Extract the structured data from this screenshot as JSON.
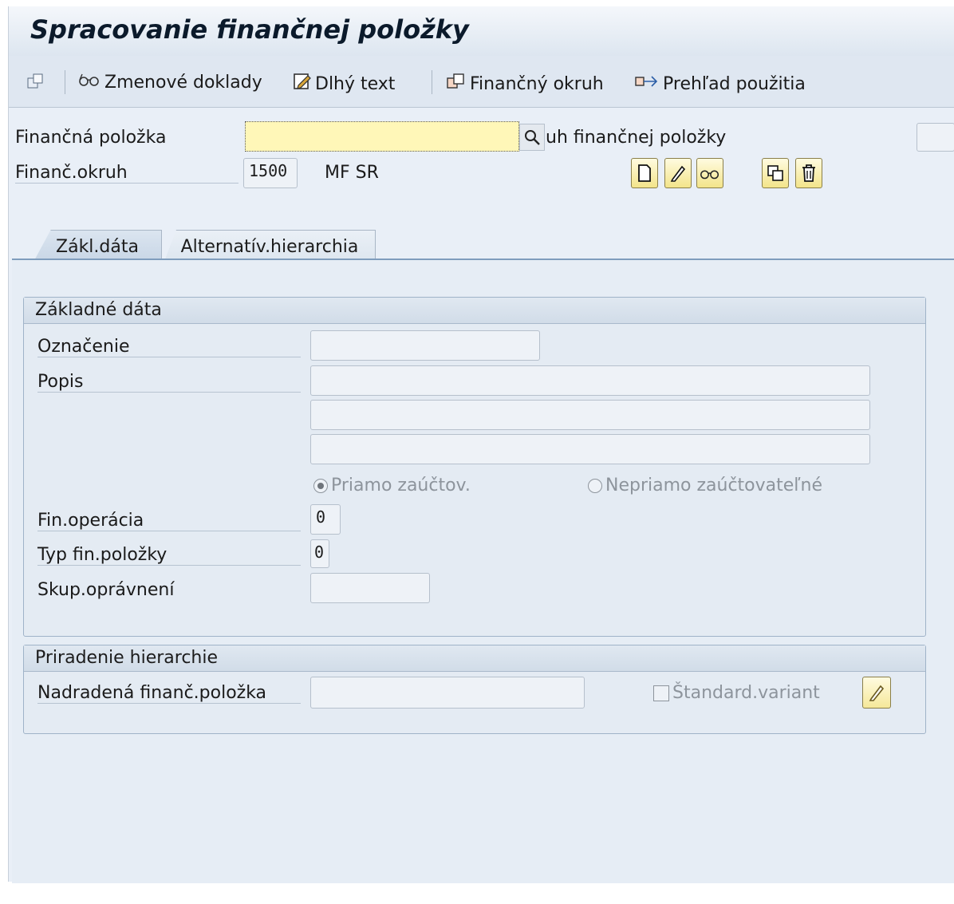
{
  "window": {
    "title": "Spracovanie finančnej položky"
  },
  "toolbar": {
    "change_docs": "Zmenové doklady",
    "long_text": "Dlhý text",
    "fin_area": "Finančný okruh",
    "usage": "Prehľad použitia"
  },
  "header": {
    "fin_item_label": "Finančná položka",
    "fin_item_value": "",
    "fin_item_type_label": "uh finančnej položky",
    "fin_area_label": "Finanč.okruh",
    "fin_area_value": "1500",
    "fin_area_text": "MF SR"
  },
  "tabs": [
    {
      "label": "Zákl.dáta",
      "active": true
    },
    {
      "label": "Alternatív.hierarchia",
      "active": false
    }
  ],
  "basic": {
    "title": "Základné dáta",
    "designation_label": "Označenie",
    "designation_value": "",
    "description_label": "Popis",
    "description_lines": [
      "",
      "",
      ""
    ],
    "radio_direct": "Priamo zaúčtov.",
    "radio_indirect": "Nepriamo zaúčtovateľné",
    "fin_operation_label": "Fin.operácia",
    "fin_operation_value": "0",
    "item_type_label": "Typ fin.položky",
    "item_type_value": "0",
    "auth_group_label": "Skup.oprávnení",
    "auth_group_value": ""
  },
  "hierarchy": {
    "title": "Priradenie hierarchie",
    "parent_label": "Nadradená finanč.položka",
    "parent_value": "",
    "std_variant_label": "Štandard.variant",
    "std_variant_checked": false
  },
  "colors": {
    "active_field": "#fff7b8",
    "panel": "#e6edf5",
    "toolbar": "#dfe7f1",
    "button_yellow": "#f3e48a"
  }
}
